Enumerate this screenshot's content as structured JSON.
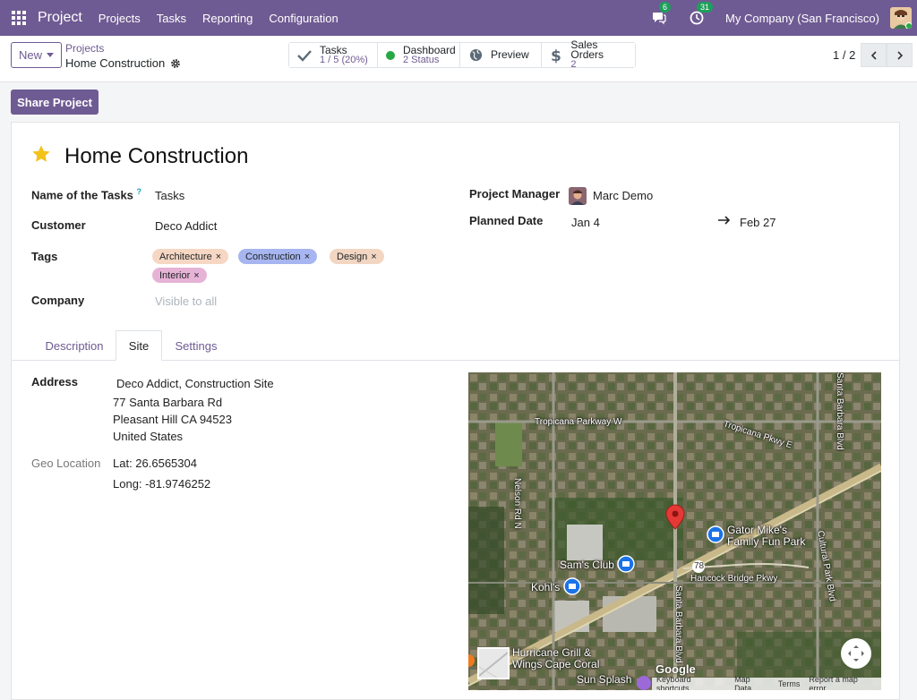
{
  "navbar": {
    "app_name": "Project",
    "menu": [
      "Projects",
      "Tasks",
      "Reporting",
      "Configuration"
    ],
    "messages_count": "6",
    "activities_count": "31",
    "company": "My Company (San Francisco)"
  },
  "control": {
    "new_label": "New",
    "breadcrumb_parent": "Projects",
    "breadcrumb_current": "Home Construction",
    "smart_buttons": [
      {
        "label": "Tasks",
        "value": "1 / 5 (20%)",
        "icon": "check-icon"
      },
      {
        "label": "Dashboard",
        "value": "2 Status",
        "icon": "status-dot-icon"
      },
      {
        "label": "Preview",
        "value": "",
        "icon": "globe-icon"
      },
      {
        "label": "Sales Orders",
        "value": "2",
        "icon": "dollar-icon"
      }
    ],
    "pager": "1 / 2"
  },
  "share_label": "Share Project",
  "form": {
    "title": "Home Construction",
    "name_tasks_label": "Name of the Tasks",
    "name_tasks_help": "?",
    "name_tasks_value": "Tasks",
    "customer_label": "Customer",
    "customer_value": "Deco Addict",
    "tags_label": "Tags",
    "tags": [
      {
        "name": "Architecture",
        "color": "#f6d7c3"
      },
      {
        "name": "Construction",
        "color": "#a7b6f0"
      },
      {
        "name": "Design",
        "color": "#f2d6c2"
      },
      {
        "name": "Interior",
        "color": "#e6b3d6"
      }
    ],
    "tag_remove": "×",
    "company_label": "Company",
    "company_placeholder": "Visible to all",
    "pm_label": "Project Manager",
    "pm_value": "Marc Demo",
    "planned_label": "Planned Date",
    "planned_start": "Jan 4",
    "planned_end": "Feb 27"
  },
  "tabs": [
    "Description",
    "Site",
    "Settings"
  ],
  "site": {
    "address_label": "Address",
    "address_lines": [
      "Deco Addict, Construction Site",
      "77 Santa Barbara Rd",
      "Pleasant Hill CA 94523",
      "United States"
    ],
    "geo_label": "Geo Location",
    "lat": "Lat: 26.6565304",
    "long": "Long: -81.9746252"
  },
  "map": {
    "labels": [
      "Tropicana Parkway W",
      "Tropicana Pkwy E",
      "Nelson Rd N",
      "Gator Mike's",
      "Family Fun Park",
      "Sam's Club",
      "Kohl's",
      "Hancock Bridge Pkwy",
      "Santa Barbara Blvd",
      "Cultural Park Blvd",
      "Hurricane Grill &",
      "Wings Cape Coral",
      "Sun Splash",
      "Santa Barbara Blvd",
      "78"
    ],
    "google": "Google",
    "footer": [
      "Keyboard shortcuts",
      "Map Data",
      "Terms",
      "Report a map error"
    ]
  }
}
